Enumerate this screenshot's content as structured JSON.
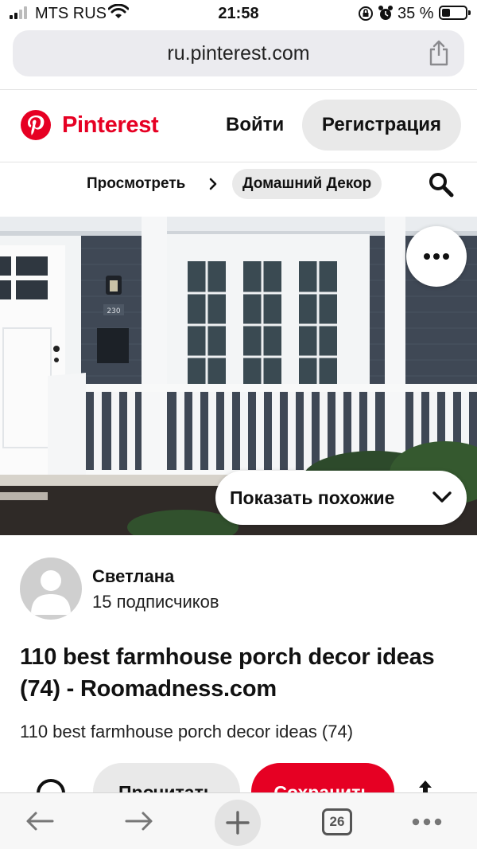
{
  "status_bar": {
    "carrier": "MTS RUS",
    "time": "21:58",
    "battery_percent": "35 %",
    "battery_level": 0.35,
    "icons": [
      "signal-icon",
      "wifi-icon",
      "rotation-lock-icon",
      "alarm-icon",
      "battery-icon"
    ]
  },
  "browser": {
    "url": "ru.pinterest.com",
    "open_tabs": "26",
    "toolbar_icons": [
      "back-arrow-icon",
      "forward-arrow-icon",
      "new-tab-plus-icon",
      "tabs-icon",
      "more-menu-icon"
    ]
  },
  "header": {
    "brand": "Pinterest",
    "login_label": "Войти",
    "signup_label": "Регистрация",
    "brand_color": "#e60023"
  },
  "breadcrumb": {
    "browse_label": "Просмотреть",
    "category_label": "Домашний Декор"
  },
  "pin": {
    "image_icons": [
      "more-dots-icon",
      "chevron-down-icon"
    ],
    "show_similar_label": "Показать похожие",
    "author": {
      "name": "Светлана",
      "followers": "15 подписчиков"
    },
    "title": "110 best farmhouse porch decor ideas (74) - Roomadness.com",
    "description": "110 best farmhouse porch decor ideas (74)",
    "actions": {
      "read_label": "Прочитать",
      "save_label": "Сохранить",
      "save_color": "#e60023"
    }
  }
}
